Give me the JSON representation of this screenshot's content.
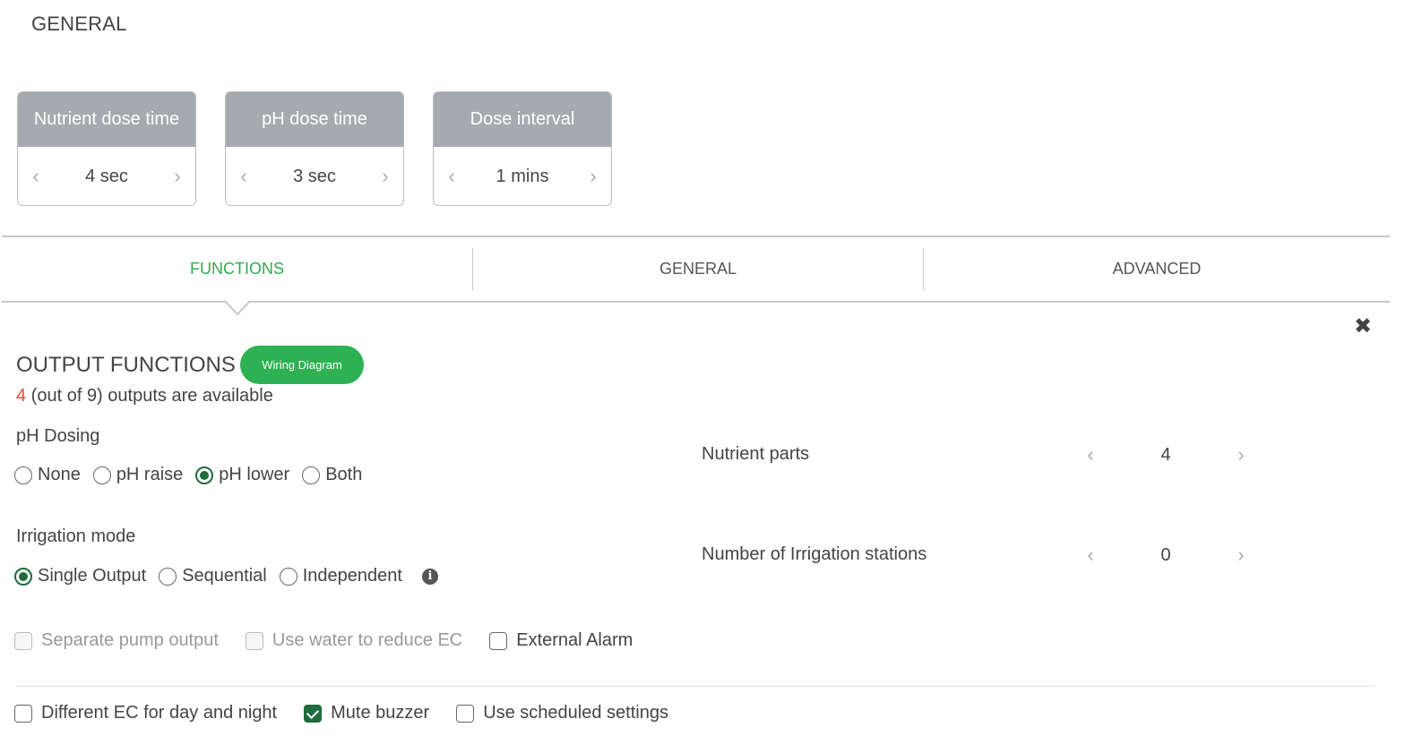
{
  "general": {
    "title": "GENERAL"
  },
  "cards": [
    {
      "title": "Nutrient dose time",
      "value": "4 sec",
      "prev_icon": "chevron-left-icon",
      "next_icon": "chevron-right-icon"
    },
    {
      "title": "pH dose time",
      "value": "3 sec",
      "prev_icon": "chevron-left-icon",
      "next_icon": "chevron-right-icon"
    },
    {
      "title": "Dose interval",
      "value": "1 mins",
      "prev_icon": "chevron-left-icon",
      "next_icon": "chevron-right-icon"
    }
  ],
  "tabs": [
    {
      "label": "FUNCTIONS",
      "active": true
    },
    {
      "label": "GENERAL",
      "active": false
    },
    {
      "label": "ADVANCED",
      "active": false
    }
  ],
  "close": {
    "icon": "close-icon",
    "glyph": "✖"
  },
  "output": {
    "title": "OUTPUT FUNCTIONS",
    "wiring_button": "Wiring Diagram",
    "available_count": "4",
    "available_text": " (out of 9) outputs are available"
  },
  "ph_dosing": {
    "label": "pH Dosing",
    "options": [
      "None",
      "pH raise",
      "pH lower",
      "Both"
    ],
    "selected": "pH lower"
  },
  "irrigation": {
    "label": "Irrigation mode",
    "options": [
      "Single Output",
      "Sequential",
      "Independent"
    ],
    "selected": "Single Output",
    "info_glyph": "i"
  },
  "nutrient_parts": {
    "label": "Nutrient parts",
    "value": "4"
  },
  "irrigation_stations": {
    "label": "Number of Irrigation stations",
    "value": "0"
  },
  "checks_row1": [
    {
      "label": "Separate pump output",
      "checked": false,
      "disabled": true
    },
    {
      "label": "Use water to reduce EC",
      "checked": false,
      "disabled": true
    },
    {
      "label": "External Alarm",
      "checked": false,
      "disabled": false
    }
  ],
  "checks_row2": [
    {
      "label": "Different EC for day and night",
      "checked": false,
      "disabled": false
    },
    {
      "label": "Mute buzzer",
      "checked": true,
      "disabled": false
    },
    {
      "label": "Use scheduled settings",
      "checked": false,
      "disabled": false
    }
  ],
  "colors": {
    "accent": "#2eab4f",
    "radio_on": "#1f6b3e",
    "count_red": "#e34a3a",
    "card_head": "#a6aaae"
  }
}
